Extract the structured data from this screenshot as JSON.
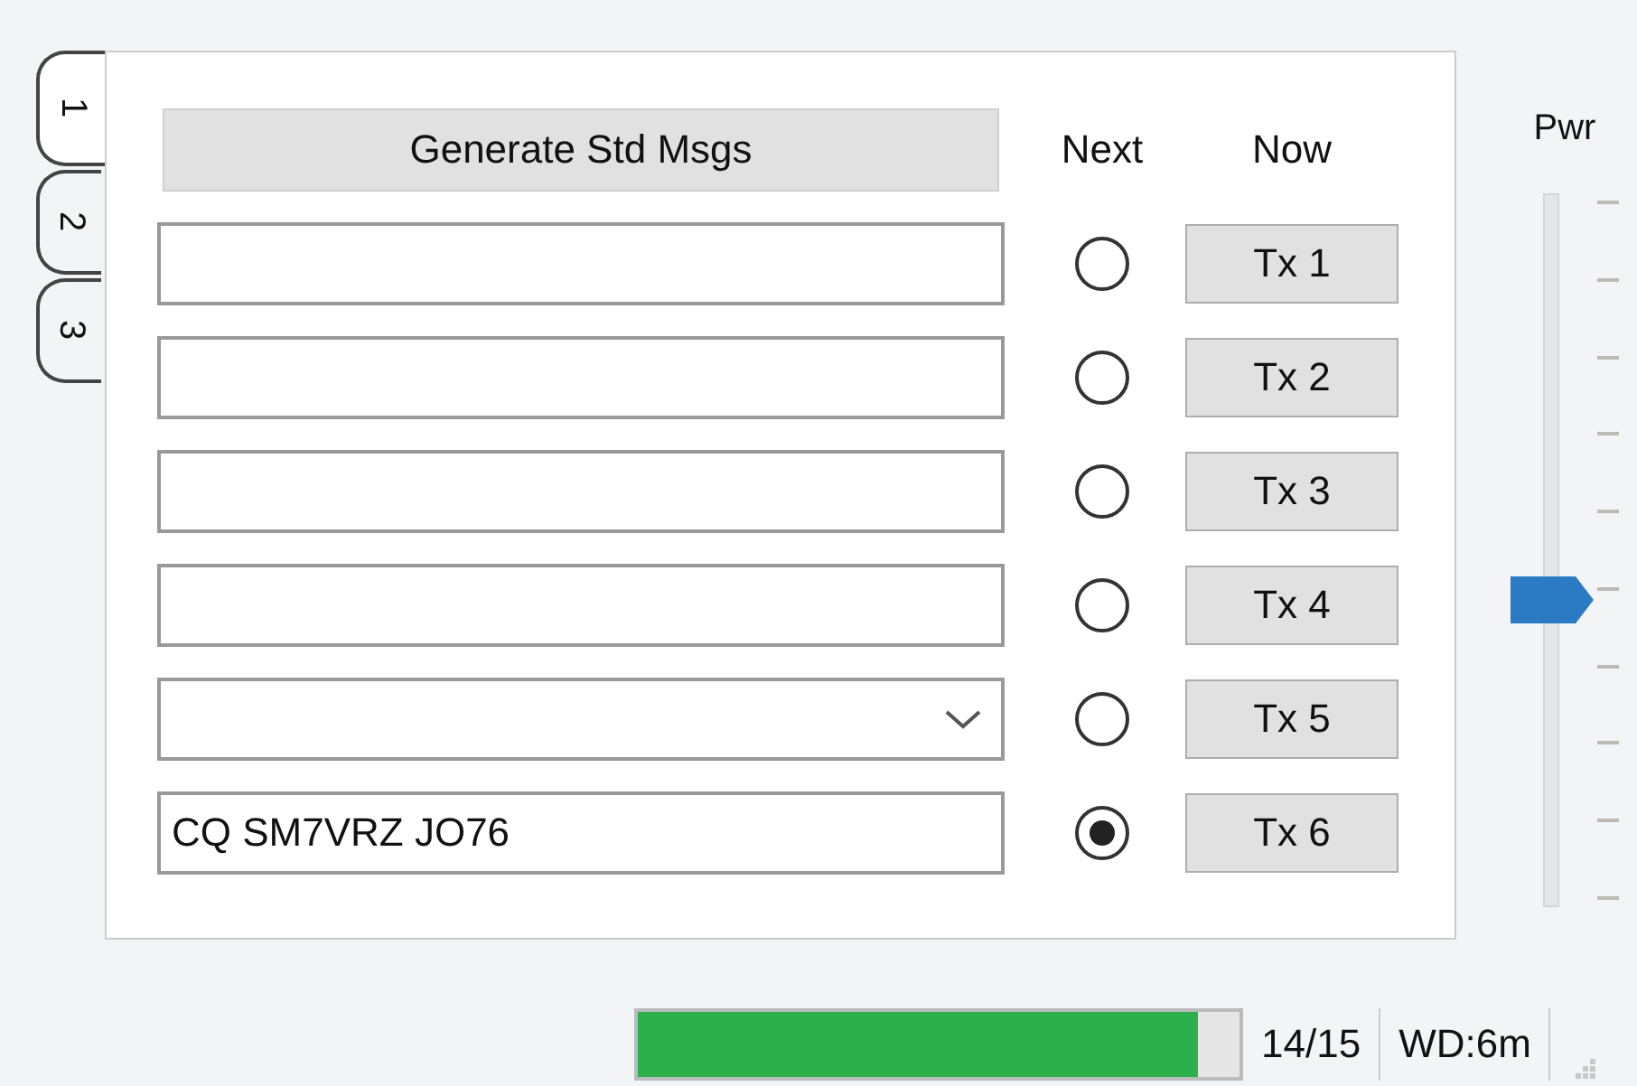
{
  "tabs": [
    {
      "label": "1",
      "selected": true
    },
    {
      "label": "2",
      "selected": false
    },
    {
      "label": "3",
      "selected": false
    }
  ],
  "generate_button": "Generate Std Msgs",
  "columns": {
    "next": "Next",
    "now": "Now"
  },
  "messages": [
    {
      "kind": "text",
      "selected": false,
      "button": "Tx 1"
    },
    {
      "kind": "text",
      "selected": false,
      "button": "Tx 2"
    },
    {
      "kind": "text",
      "selected": false,
      "button": "Tx 3"
    },
    {
      "kind": "text",
      "selected": false,
      "button": "Tx 4"
    },
    {
      "kind": "dropdown",
      "selected": false,
      "button": "Tx 5"
    },
    {
      "kind": "text",
      "value": "CQ SM7VRZ JO76",
      "selected": true,
      "button": "Tx 6"
    }
  ],
  "power": {
    "label": "Pwr",
    "level": 0.43
  },
  "status_bar": {
    "progress": {
      "level": 0.93
    },
    "count": "14/15",
    "watchdog": "WD:6m"
  }
}
